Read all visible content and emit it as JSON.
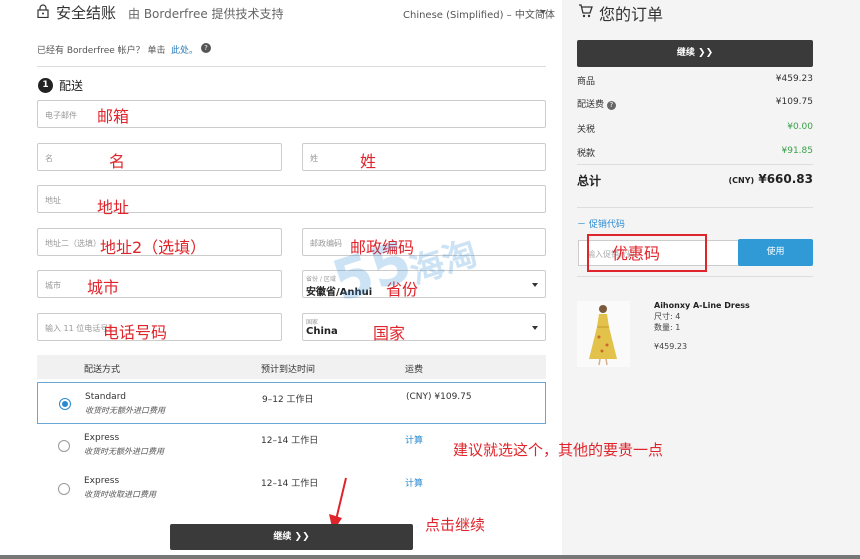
{
  "header": {
    "title": "安全结账",
    "subtitle": "由 Borderfree 提供技术支持",
    "language": "Chinese (Simplified) – 中文简体",
    "lock_icon": "lock-icon"
  },
  "signin": {
    "text": "已经有 Borderfree 帐户？ 单击",
    "link": "此处。",
    "help_icon": "?"
  },
  "step": {
    "number": "1",
    "label": "配送"
  },
  "form": {
    "email_placeholder": "电子邮件",
    "first_name_placeholder": "名",
    "last_name_placeholder": "姓",
    "address_placeholder": "地址",
    "address2_placeholder": "地址二（选填）",
    "postal_placeholder": "邮政编码",
    "city_placeholder": "城市",
    "province_label": "省份 / 区域",
    "province_value": "安徽省/Anhui",
    "phone_placeholder": "输入 11 位电话号码",
    "country_label": "国家",
    "country_value": "China"
  },
  "annotations": {
    "email": "邮箱",
    "first_name": "名",
    "last_name": "姓",
    "address": "地址",
    "address2": "地址2（选填）",
    "postal": "邮政编码",
    "city": "城市",
    "province": "省份",
    "phone": "电话号码",
    "country": "国家",
    "promo": "优惠码",
    "advice": "建议就选这个，其他的要贵一点",
    "click_continue": "点击继续"
  },
  "shipping": {
    "headers": {
      "method": "配送方式",
      "eta": "预计到达时间",
      "cost": "运费"
    },
    "options": [
      {
        "name": "Standard",
        "note": "收货时无额外进口费用",
        "eta": "9–12 工作日",
        "cost": "(CNY) ¥109.75",
        "selected": true
      },
      {
        "name": "Express",
        "note": "收货时无额外进口费用",
        "eta": "12–14 工作日",
        "cost": "计算",
        "selected": false
      },
      {
        "name": "Express",
        "note": "收货时收取进口费用",
        "eta": "12–14 工作日",
        "cost": "计算",
        "selected": false
      }
    ]
  },
  "continue_label": "继续 ❯❯",
  "order": {
    "title": "您的订单",
    "continue_label": "继续 ❯❯",
    "rows": [
      {
        "label": "商品",
        "value": "¥459.23",
        "green": false
      },
      {
        "label": "配送费",
        "value": "¥109.75",
        "green": false
      },
      {
        "label": "关税",
        "value": "¥0.00",
        "green": true
      },
      {
        "label": "税款",
        "value": "¥91.85",
        "green": true
      }
    ],
    "total_label": "总计",
    "total_currency": "(CNY)",
    "total_value": "¥660.83",
    "promo_link": "－ 促销代码",
    "promo_placeholder": "输入促销代码",
    "apply_label": "使用",
    "product": {
      "name": "Aihonxy A-Line Dress",
      "size": "尺寸: 4",
      "qty": "数量: 1",
      "price": "¥459.23"
    }
  },
  "colors": {
    "accent_blue": "#2f9ad6",
    "annotation_red": "#e0242b",
    "dark_button": "#3a3a3a",
    "green": "#3aa048"
  }
}
